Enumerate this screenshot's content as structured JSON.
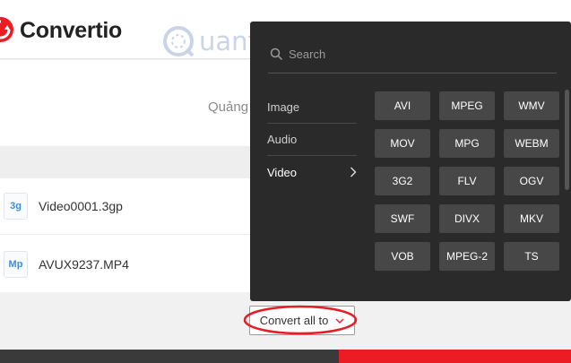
{
  "header": {
    "logo_text": "Convertio"
  },
  "watermark": {
    "text": "uantrimang"
  },
  "ad": {
    "text": "Quảng"
  },
  "files": [
    {
      "badge": "3g",
      "name": "Video0001.3gp"
    },
    {
      "badge": "Mp",
      "name": "AVUX9237.MP4"
    }
  ],
  "convert_button": {
    "label": "Convert all to"
  },
  "dropdown": {
    "search_placeholder": "Search",
    "categories": [
      "Image",
      "Audio",
      "Video"
    ],
    "active_category": "Video",
    "formats": [
      "AVI",
      "MPEG",
      "WMV",
      "MOV",
      "MPG",
      "WEBM",
      "3G2",
      "FLV",
      "OGV",
      "SWF",
      "DIVX",
      "MKV",
      "VOB",
      "MPEG-2",
      "TS"
    ]
  },
  "colors": {
    "brand_red": "#ec1c24",
    "panel_bg": "#2a2a2a",
    "format_button_bg": "#474747",
    "badge_blue": "#3a8fd8",
    "highlight": "#e31e24"
  }
}
